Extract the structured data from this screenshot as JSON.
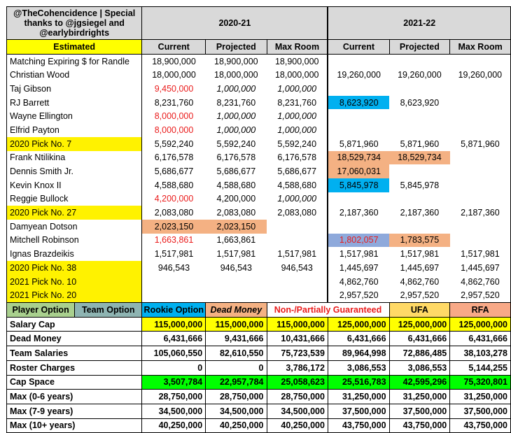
{
  "title": "@TheCohencidence | Special thanks to @jgsiegel and @earlybirdrights",
  "season_2020": "2020-21",
  "season_2021": "2021-22",
  "estimated": "Estimated",
  "col_current": "Current",
  "col_projected": "Projected",
  "col_max_room": "Max Room",
  "rows": [
    {
      "name": "Matching Expiring $ for Randle",
      "c20": "18,900,000",
      "p20": "18,900,000",
      "m20": "18,900,000",
      "c21": "",
      "p21": "",
      "m21": ""
    },
    {
      "name": "Christian Wood",
      "c20": "18,000,000",
      "p20": "18,000,000",
      "m20": "18,000,000",
      "c21": "19,260,000",
      "p21": "19,260,000",
      "m21": "19,260,000"
    },
    {
      "name": "Taj Gibson",
      "c20": "9,450,000",
      "p20": "1,000,000",
      "m20": "1,000,000",
      "c21": "",
      "p21": "",
      "m21": ""
    },
    {
      "name": "RJ Barrett",
      "c20": "8,231,760",
      "p20": "8,231,760",
      "m20": "8,231,760",
      "c21": "8,623,920",
      "p21": "8,623,920",
      "m21": ""
    },
    {
      "name": "Wayne Ellington",
      "c20": "8,000,000",
      "p20": "1,000,000",
      "m20": "1,000,000",
      "c21": "",
      "p21": "",
      "m21": ""
    },
    {
      "name": "Elfrid Payton",
      "c20": "8,000,000",
      "p20": "1,000,000",
      "m20": "1,000,000",
      "c21": "",
      "p21": "",
      "m21": ""
    },
    {
      "name": "2020 Pick No. 7",
      "c20": "5,592,240",
      "p20": "5,592,240",
      "m20": "5,592,240",
      "c21": "5,871,960",
      "p21": "5,871,960",
      "m21": "5,871,960"
    },
    {
      "name": "Frank Ntilikina",
      "c20": "6,176,578",
      "p20": "6,176,578",
      "m20": "6,176,578",
      "c21": "18,529,734",
      "p21": "18,529,734",
      "m21": ""
    },
    {
      "name": "Dennis Smith Jr.",
      "c20": "5,686,677",
      "p20": "5,686,677",
      "m20": "5,686,677",
      "c21": "17,060,031",
      "p21": "",
      "m21": ""
    },
    {
      "name": "Kevin Knox II",
      "c20": "4,588,680",
      "p20": "4,588,680",
      "m20": "4,588,680",
      "c21": "5,845,978",
      "p21": "5,845,978",
      "m21": ""
    },
    {
      "name": "Reggie Bullock",
      "c20": "4,200,000",
      "p20": "4,200,000",
      "m20": "1,000,000",
      "c21": "",
      "p21": "",
      "m21": ""
    },
    {
      "name": "2020 Pick No. 27",
      "c20": "2,083,080",
      "p20": "2,083,080",
      "m20": "2,083,080",
      "c21": "2,187,360",
      "p21": "2,187,360",
      "m21": "2,187,360"
    },
    {
      "name": "Damyean Dotson",
      "c20": "2,023,150",
      "p20": "2,023,150",
      "m20": "",
      "c21": "",
      "p21": "",
      "m21": ""
    },
    {
      "name": "Mitchell Robinson",
      "c20": "1,663,861",
      "p20": "1,663,861",
      "m20": "",
      "c21": "1,802,057",
      "p21": "1,783,575",
      "m21": ""
    },
    {
      "name": "Ignas Brazdeikis",
      "c20": "1,517,981",
      "p20": "1,517,981",
      "m20": "1,517,981",
      "c21": "1,517,981",
      "p21": "1,517,981",
      "m21": "1,517,981"
    },
    {
      "name": "2020 Pick No. 38",
      "c20": "946,543",
      "p20": "946,543",
      "m20": "946,543",
      "c21": "1,445,697",
      "p21": "1,445,697",
      "m21": "1,445,697"
    },
    {
      "name": "2021 Pick No. 10",
      "c20": "",
      "p20": "",
      "m20": "",
      "c21": "4,862,760",
      "p21": "4,862,760",
      "m21": "4,862,760"
    },
    {
      "name": "2021 Pick No. 20",
      "c20": "",
      "p20": "",
      "m20": "",
      "c21": "2,957,520",
      "p21": "2,957,520",
      "m21": "2,957,520"
    }
  ],
  "legend": {
    "player_option": "Player Option",
    "team_option": "Team Option",
    "rookie_option": "Rookie Option",
    "dead_money": "Dead Money",
    "non_guaranteed": "Non-/Partially Guaranteed",
    "ufa": "UFA",
    "rfa": "RFA"
  },
  "summary": [
    {
      "label": "Salary Cap",
      "v": [
        "115,000,000",
        "115,000,000",
        "115,000,000",
        "125,000,000",
        "125,000,000",
        "125,000,000"
      ]
    },
    {
      "label": "Dead Money",
      "v": [
        "6,431,666",
        "9,431,666",
        "10,431,666",
        "6,431,666",
        "6,431,666",
        "6,431,666"
      ]
    },
    {
      "label": "Team Salaries",
      "v": [
        "105,060,550",
        "82,610,550",
        "75,723,539",
        "89,964,998",
        "72,886,485",
        "38,103,278"
      ]
    },
    {
      "label": "Roster Charges",
      "v": [
        "0",
        "0",
        "3,786,172",
        "3,086,553",
        "3,086,553",
        "5,144,255"
      ]
    },
    {
      "label": "Cap Space",
      "v": [
        "3,507,784",
        "22,957,784",
        "25,058,623",
        "25,516,783",
        "42,595,296",
        "75,320,801"
      ]
    },
    {
      "label": "Max (0-6 years)",
      "v": [
        "28,750,000",
        "28,750,000",
        "28,750,000",
        "31,250,000",
        "31,250,000",
        "31,250,000"
      ]
    },
    {
      "label": "Max (7-9 years)",
      "v": [
        "34,500,000",
        "34,500,000",
        "34,500,000",
        "37,500,000",
        "37,500,000",
        "37,500,000"
      ]
    },
    {
      "label": "Max (10+ years)",
      "v": [
        "40,250,000",
        "40,250,000",
        "40,250,000",
        "43,750,000",
        "43,750,000",
        "43,750,000"
      ]
    }
  ],
  "colors": {
    "yellow": "#ffff00",
    "orange_dead_money": "#f4b183",
    "blue_rookie": "#00b0f0",
    "lavender": "#8ea9db",
    "green_cap_space": "#00ff00",
    "red_non_guaranteed": "#ea1c1c"
  }
}
